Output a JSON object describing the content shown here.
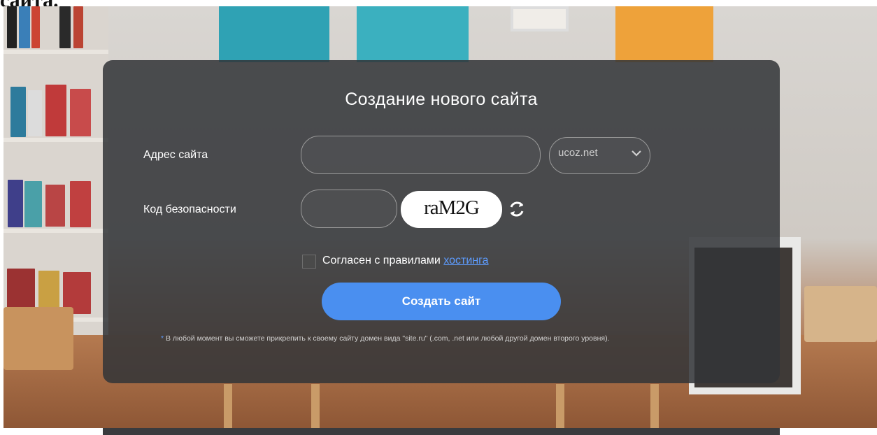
{
  "heading_fragment": "сайта.",
  "form": {
    "title": "Создание нового сайта",
    "address_label": "Адрес сайта",
    "address_value": "",
    "domain_selected": "ucoz.net",
    "security_label": "Код безопасности",
    "security_value": "",
    "captcha_text": "raM2G",
    "agree_text": "Согласен с правилами",
    "agree_link": "хостинга",
    "submit_label": "Создать сайт",
    "note_star": "*",
    "note_text": "В любой момент вы сможете прикрепить к своему сайту домен вида \"site.ru\" (.com, .net или любой другой домен второго уровня)."
  },
  "colors": {
    "panel_bg": "#323438",
    "button_bg": "#4a8ff0",
    "link": "#5d9cff"
  },
  "icons": {
    "domain_dropdown": "chevron-down-icon",
    "captcha_refresh": "refresh-icon"
  }
}
